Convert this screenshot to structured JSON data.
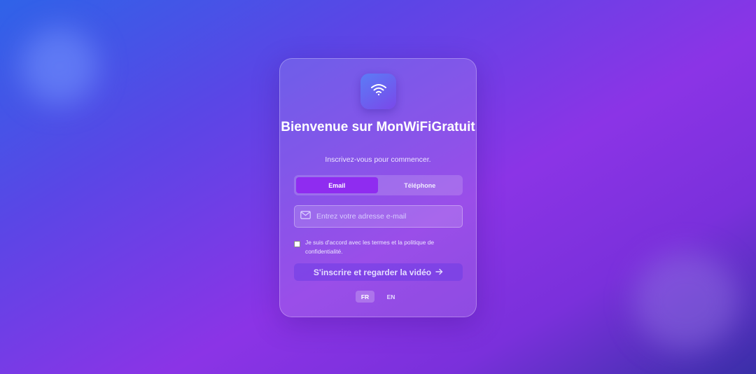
{
  "brand": {
    "icon": "wifi-icon",
    "title": "Bienvenue sur MonWiFiGratuit",
    "subtitle": "Inscrivez-vous pour commencer."
  },
  "tabs": [
    {
      "label": "Email",
      "active": true
    },
    {
      "label": "Téléphone",
      "active": false
    }
  ],
  "email_field": {
    "icon": "mail-icon",
    "value": "",
    "placeholder": "Entrez votre adresse e-mail"
  },
  "consent": {
    "checked": false,
    "label": "Je suis d'accord avec les termes et la politique de confidentialité."
  },
  "submit": {
    "label": "S'inscrire et regarder la vidéo",
    "icon": "arrow-right-icon"
  },
  "languages": [
    {
      "label": "FR",
      "active": true
    },
    {
      "label": "EN",
      "active": false
    }
  ],
  "colors": {
    "accent": "#8f2cf0",
    "background_start": "#2f63e8",
    "background_end": "#8b34e6"
  }
}
